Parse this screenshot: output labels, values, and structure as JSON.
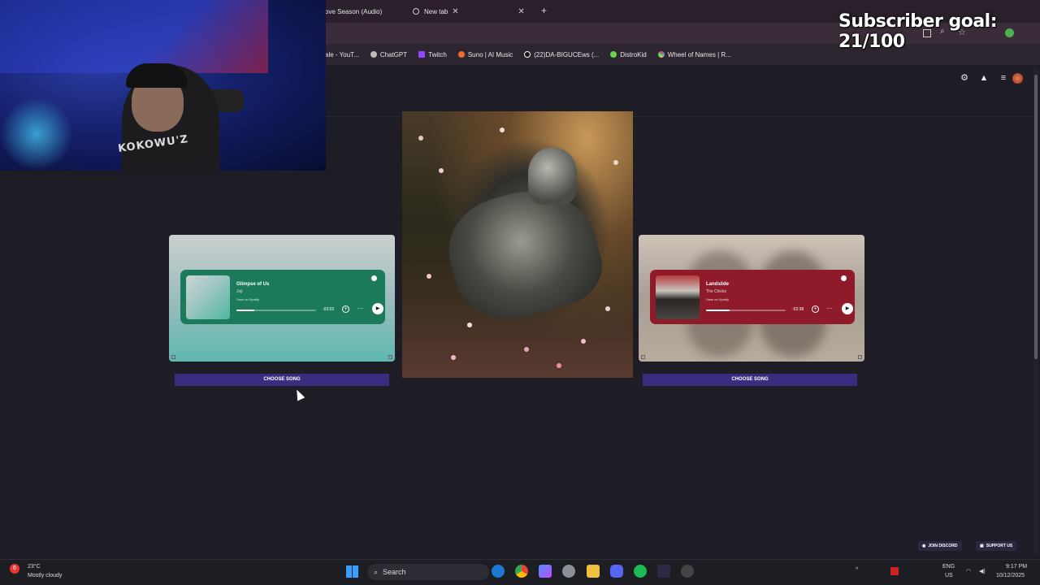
{
  "browser": {
    "tabs": [
      {
        "label": "ove Season (Audio)"
      },
      {
        "label": "New tab"
      }
    ],
    "new_tab_symbol": "+",
    "bookmarks": [
      {
        "label": "ale - YouT...",
        "icon": "youtube-icon",
        "color": "#ff0000"
      },
      {
        "label": "ChatGPT",
        "icon": "chatgpt-icon",
        "color": "#bbbbbb"
      },
      {
        "label": "Twitch",
        "icon": "twitch-icon",
        "color": "#9146ff"
      },
      {
        "label": "Suno | AI Music",
        "icon": "suno-icon",
        "color": "#f06a2a"
      },
      {
        "label": "(22)DA-BIGUCEws (...",
        "icon": "tiktok-icon",
        "color": "#ffffff"
      },
      {
        "label": "DistroKid",
        "icon": "distrokid-icon",
        "color": "#6ad24a"
      },
      {
        "label": "Wheel of Names | R...",
        "icon": "wheel-icon",
        "color": "#e04444"
      }
    ]
  },
  "overlay": {
    "subscriber_goal": "Subscriber goal: 21/100",
    "shirt_text": "KOKOWU'Z"
  },
  "cards": {
    "left": {
      "title": "Glimpse of Us",
      "artist": "Joji",
      "save": "Save on Spotify",
      "time": "-03:02",
      "progress": 0.22,
      "button": "CHOOSE SONG"
    },
    "right": {
      "title": "Landslide",
      "artist": "The Chicks",
      "save": "Save on Spotify",
      "time": "-02:38",
      "progress": 0.3,
      "button": "CHOOSE SONG"
    }
  },
  "footer": {
    "discord": "JOIN DISCORD",
    "support": "SUPPORT US"
  },
  "taskbar": {
    "weather_temp": "23°C",
    "weather_desc": "Mostly cloudy",
    "weather_badge": "6",
    "search_placeholder": "Search",
    "lang_top": "ENG",
    "lang_bottom": "US",
    "time": "9:17 PM",
    "date": "10/12/2025"
  },
  "colors": {
    "accent_button": "#3a2d80",
    "left_player": "#1a7a5a",
    "right_player": "#8e1a2a",
    "page_bg": "#1e1d25"
  }
}
